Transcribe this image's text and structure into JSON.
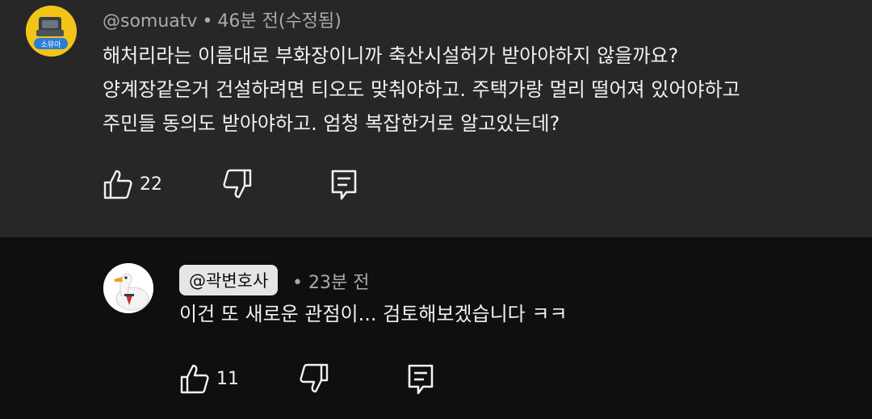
{
  "comment": {
    "author": "@somuatv",
    "time": "46분 전(수정됨)",
    "lines": [
      "해처리라는 이름대로 부화장이니까 축산시설허가 받아야하지 않을까요?",
      "양계장같은거 건설하려면 티오도 맞춰야하고. 주택가랑 멀리 떨어져 있어야하고",
      "주민들 동의도 받아야하고. 엄청 복잡한거로 알고있는데?"
    ],
    "avatar_text": "소뮤아",
    "like_count": "22",
    "icons": {
      "like": "thumbs-up-icon",
      "dislike": "thumbs-down-icon",
      "reply": "reply-comment-icon"
    }
  },
  "reply": {
    "author": "@곽변호사",
    "time": "23분 전",
    "text": "이건 또 새로운 관점이... 검토해보겠습니다 ㅋㅋ",
    "like_count": "11"
  },
  "separator": "•",
  "colors": {
    "top_background": "#272727",
    "reply_background": "#0f0f0f",
    "text": "#f1f1f1",
    "meta": "#aaaaaa",
    "chip_background": "#e5e5e5",
    "avatar_top": "#f2c418"
  }
}
